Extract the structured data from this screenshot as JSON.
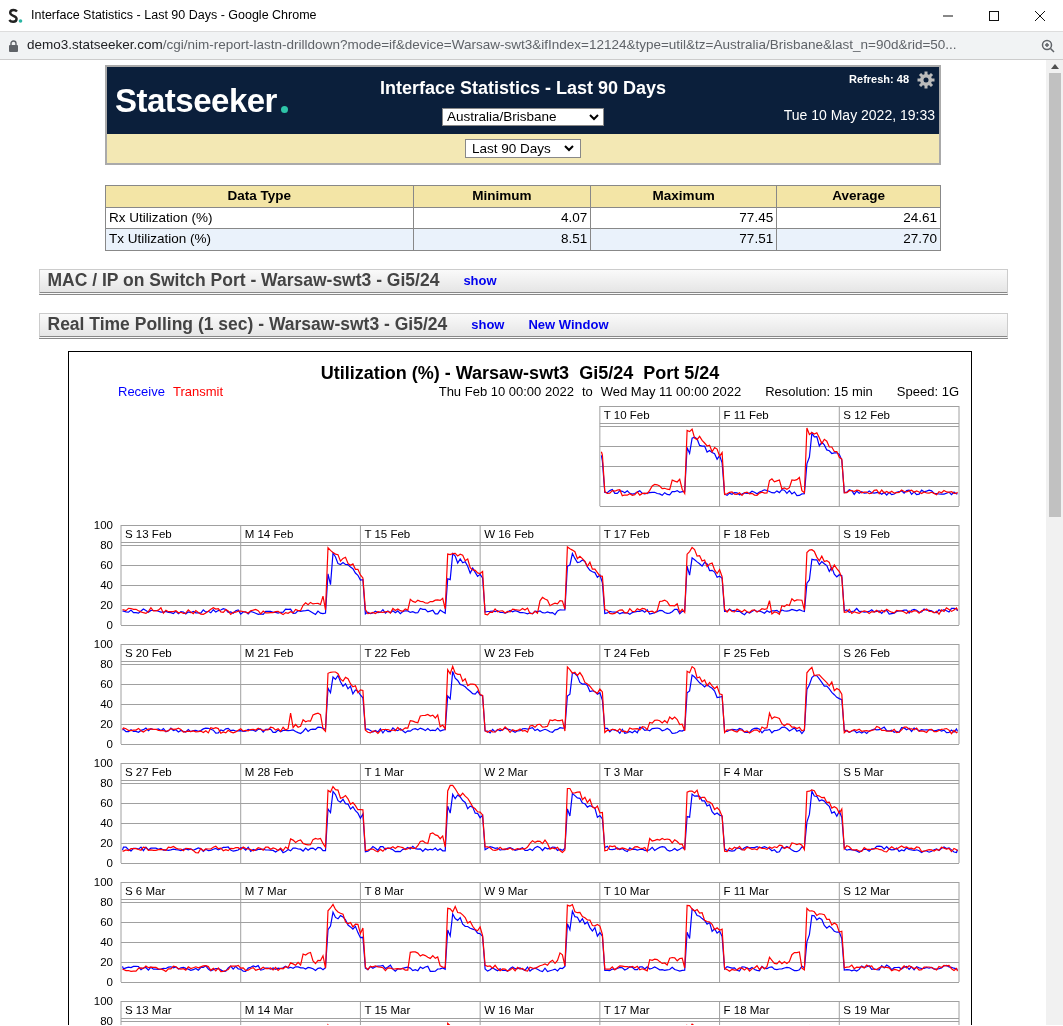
{
  "window": {
    "title": "Interface Statistics - Last 90 Days - Google Chrome"
  },
  "address_bar": {
    "host": "demo3.statseeker.com",
    "path": "/cgi/nim-report-lastn-drilldown?mode=if&device=Warsaw-swt3&ifIndex=12124&type=util&tz=Australia/Brisbane&last_n=90d&rid=50..."
  },
  "header": {
    "logo": "Statseeker",
    "title": "Interface Statistics - Last 90 Days",
    "refresh": "Refresh: 48",
    "timezone_select": "Australia/Brisbane",
    "datetime": "Tue 10 May 2022, 19:33",
    "period_select": "Last 90 Days"
  },
  "stats_table": {
    "columns": [
      "Data Type",
      "Minimum",
      "Maximum",
      "Average"
    ],
    "rows": [
      [
        "Rx Utilization (%)",
        "4.07",
        "77.45",
        "24.61"
      ],
      [
        "Tx Utilization (%)",
        "8.51",
        "77.51",
        "27.70"
      ]
    ]
  },
  "sections": [
    {
      "title": "MAC / IP on Switch Port - Warsaw-swt3 - Gi5/24",
      "links": [
        "show"
      ]
    },
    {
      "title": "Real Time Polling (1 sec) - Warsaw-swt3 - Gi5/24",
      "links": [
        "show",
        "New Window"
      ]
    }
  ],
  "chart": {
    "title": "Utilization (%) - Warsaw-swt3  Gi5/24  Port 5/24",
    "series": [
      {
        "name": "Receive",
        "color": "#0000ff"
      },
      {
        "name": "Transmit",
        "color": "#ff0000"
      }
    ],
    "range_from": "Thu Feb 10 00:00 2022",
    "range_to_label": "to",
    "range_to": "Wed May 11 00:00 2022",
    "resolution": "Resolution: 15 min",
    "speed": "Speed: 1G",
    "weeks": [
      {
        "days": [
          "T 10 Feb",
          "F 11 Feb",
          "S 12 Feb"
        ]
      },
      {
        "days": [
          "S 13 Feb",
          "M 14 Feb",
          "T 15 Feb",
          "W 16 Feb",
          "T 17 Feb",
          "F 18 Feb",
          "S 19 Feb"
        ],
        "yticks": [
          "100",
          "80",
          "60",
          "40",
          "20",
          "0"
        ]
      },
      {
        "days": [
          "S 20 Feb",
          "M 21 Feb",
          "T 22 Feb",
          "W 23 Feb",
          "T 24 Feb",
          "F 25 Feb",
          "S 26 Feb"
        ],
        "yticks": [
          "100",
          "80",
          "60",
          "40",
          "20",
          "0"
        ]
      },
      {
        "days": [
          "S 27 Feb",
          "M 28 Feb",
          "T 1 Mar",
          "W 2 Mar",
          "T 3 Mar",
          "F 4 Mar",
          "S 5 Mar"
        ],
        "yticks": [
          "100",
          "80",
          "60",
          "40",
          "20",
          "0"
        ]
      },
      {
        "days": [
          "S 6 Mar",
          "M 7 Mar",
          "T 8 Mar",
          "W 9 Mar",
          "T 10 Mar",
          "F 11 Mar",
          "S 12 Mar"
        ],
        "yticks": [
          "100",
          "80",
          "60",
          "40",
          "20",
          "0"
        ]
      },
      {
        "days": [
          "S 13 Mar",
          "M 14 Mar",
          "T 15 Mar",
          "W 16 Mar",
          "T 17 Mar",
          "F 18 Mar",
          "S 19 Mar"
        ],
        "yticks": [
          "100",
          "80"
        ]
      }
    ]
  }
}
